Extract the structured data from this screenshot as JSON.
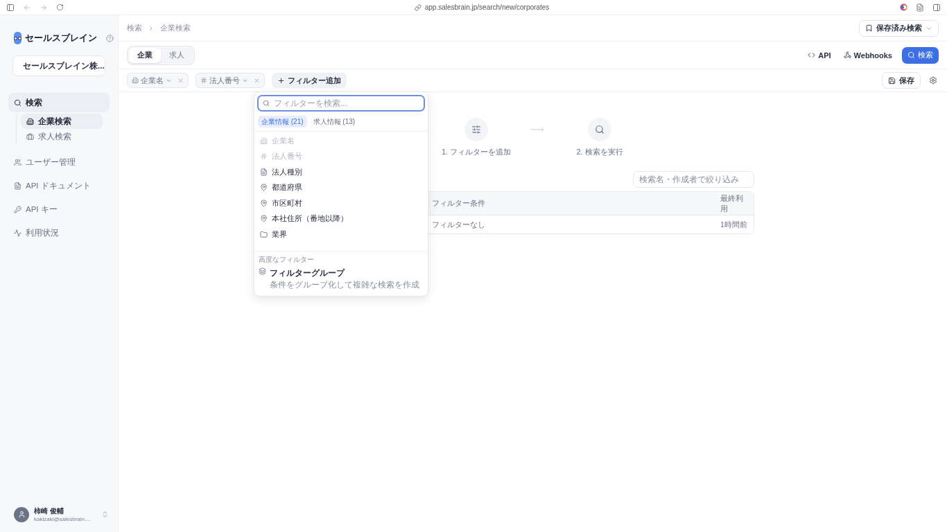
{
  "browser": {
    "url": "app.salesbrain.jp/search/new/corporates"
  },
  "sidebar": {
    "logo": "セールスブレイン",
    "org": "セールスブレイン株...",
    "items": [
      {
        "label": "検索",
        "kind": "search",
        "selected": true,
        "children": [
          {
            "label": "企業検索",
            "kind": "building",
            "selected": true
          },
          {
            "label": "求人検索",
            "kind": "briefcase",
            "selected": false
          }
        ]
      },
      {
        "label": "ユーザー管理",
        "kind": "users",
        "selected": false
      },
      {
        "label": "API ドキュメント",
        "kind": "document",
        "selected": false
      },
      {
        "label": "API キー",
        "kind": "key",
        "selected": false
      },
      {
        "label": "利用状況",
        "kind": "activity",
        "selected": false
      }
    ],
    "user": {
      "name": "柿崎 俊輔",
      "email": "kakizaki@salesbrain...."
    }
  },
  "breadcrumb": [
    "検索",
    "企業検索"
  ],
  "saved_searches": "保存済み検索",
  "tabs": [
    {
      "label": "企業",
      "selected": true
    },
    {
      "label": "求人",
      "selected": false
    }
  ],
  "actions": {
    "api": "API",
    "webhooks": "Webhooks",
    "search": "検索"
  },
  "filters": [
    {
      "label": "企業名",
      "kind": "building"
    },
    {
      "label": "法人番号",
      "kind": "hash"
    }
  ],
  "add_filter": "フィルター追加",
  "save": "保存",
  "dropdown": {
    "placeholder": "フィルターを検索...",
    "tabs": [
      {
        "label": "企業情報 (21)",
        "selected": true
      },
      {
        "label": "求人情報 (13)",
        "selected": false
      }
    ],
    "items": [
      {
        "label": "企業名",
        "kind": "building",
        "disabled": true
      },
      {
        "label": "法人番号",
        "kind": "hash",
        "disabled": true
      },
      {
        "label": "法人種別",
        "kind": "document",
        "disabled": false
      },
      {
        "label": "都道府県",
        "kind": "pin",
        "disabled": false
      },
      {
        "label": "市区町村",
        "kind": "pin",
        "disabled": false
      },
      {
        "label": "本社住所（番地以降）",
        "kind": "pin",
        "disabled": false
      },
      {
        "label": "業界",
        "kind": "folder",
        "disabled": false
      }
    ],
    "advanced_heading": "高度なフィルター",
    "group": {
      "title": "フィルターグループ",
      "description": "条件をグループ化して複雑な検索を作成"
    }
  },
  "steps": [
    {
      "label": "1. フィルターを追加",
      "kind": "filter"
    },
    {
      "label": "2. 検索を実行",
      "kind": "search"
    }
  ],
  "history": {
    "filter_placeholder": "検索名・作成者で絞り込み",
    "columns": [
      "フィルター条件",
      "最終利用"
    ],
    "rows": [
      [
        "フィルターなし",
        "1時間前"
      ]
    ]
  }
}
